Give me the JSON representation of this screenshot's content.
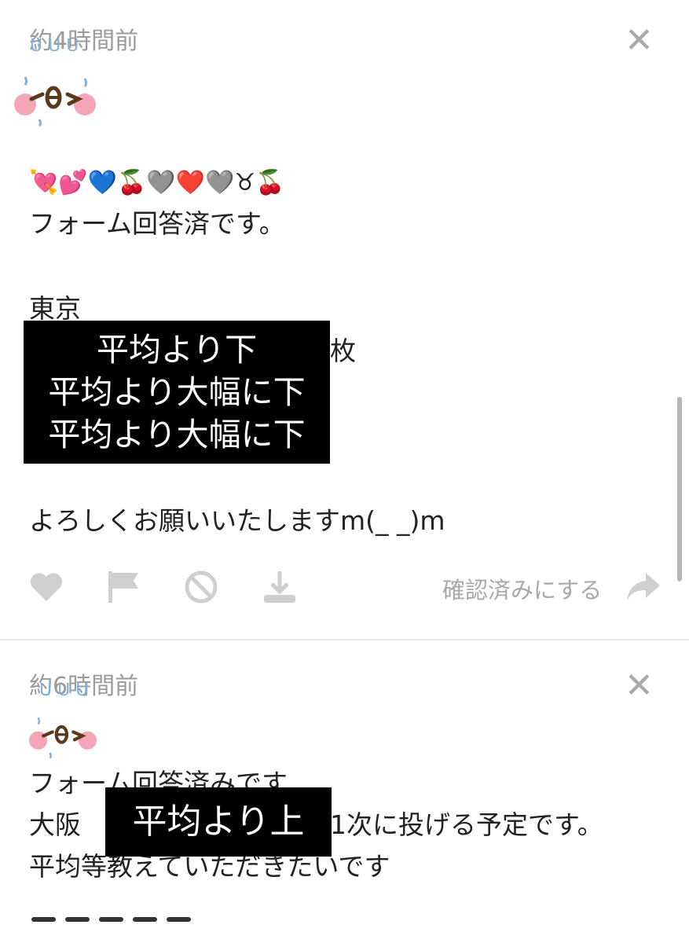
{
  "posts": [
    {
      "timestamp": "約4時間前",
      "close_label": "✕",
      "emoji_line": "💘💕💙🍒🩶❤️🩶♉🍒",
      "lines": [
        "フォーム回答済です。",
        "東京",
        "枚"
      ],
      "overlay_lines": [
        "平均より下",
        "平均より大幅に下",
        "平均より大幅に下"
      ],
      "closing": "よろしくお願いいたしますm(_ _)m",
      "actions": {
        "like_icon": "heart-icon",
        "flag_icon": "flag-icon",
        "block_icon": "ban-icon",
        "download_icon": "download-icon",
        "confirm_label": "確認済みにする",
        "share_icon": "share-arrow-icon"
      }
    },
    {
      "timestamp": "約6時間前",
      "close_label": "✕",
      "lines": [
        "フォーム回答済みです",
        "大阪",
        "1次に投げる予定です。",
        "平均等教えていただきたいです"
      ],
      "overlay_lines": [
        "平均より上"
      ]
    }
  ],
  "colors": {
    "timestamp": "#9b9b9b",
    "action_icons": "#cfcfcf",
    "overlay_bg": "#000000",
    "overlay_text": "#ffffff",
    "avatar_face": "#5a3a1a",
    "avatar_cheek": "#f4a6b8",
    "avatar_drops": "#7fb0e0"
  }
}
